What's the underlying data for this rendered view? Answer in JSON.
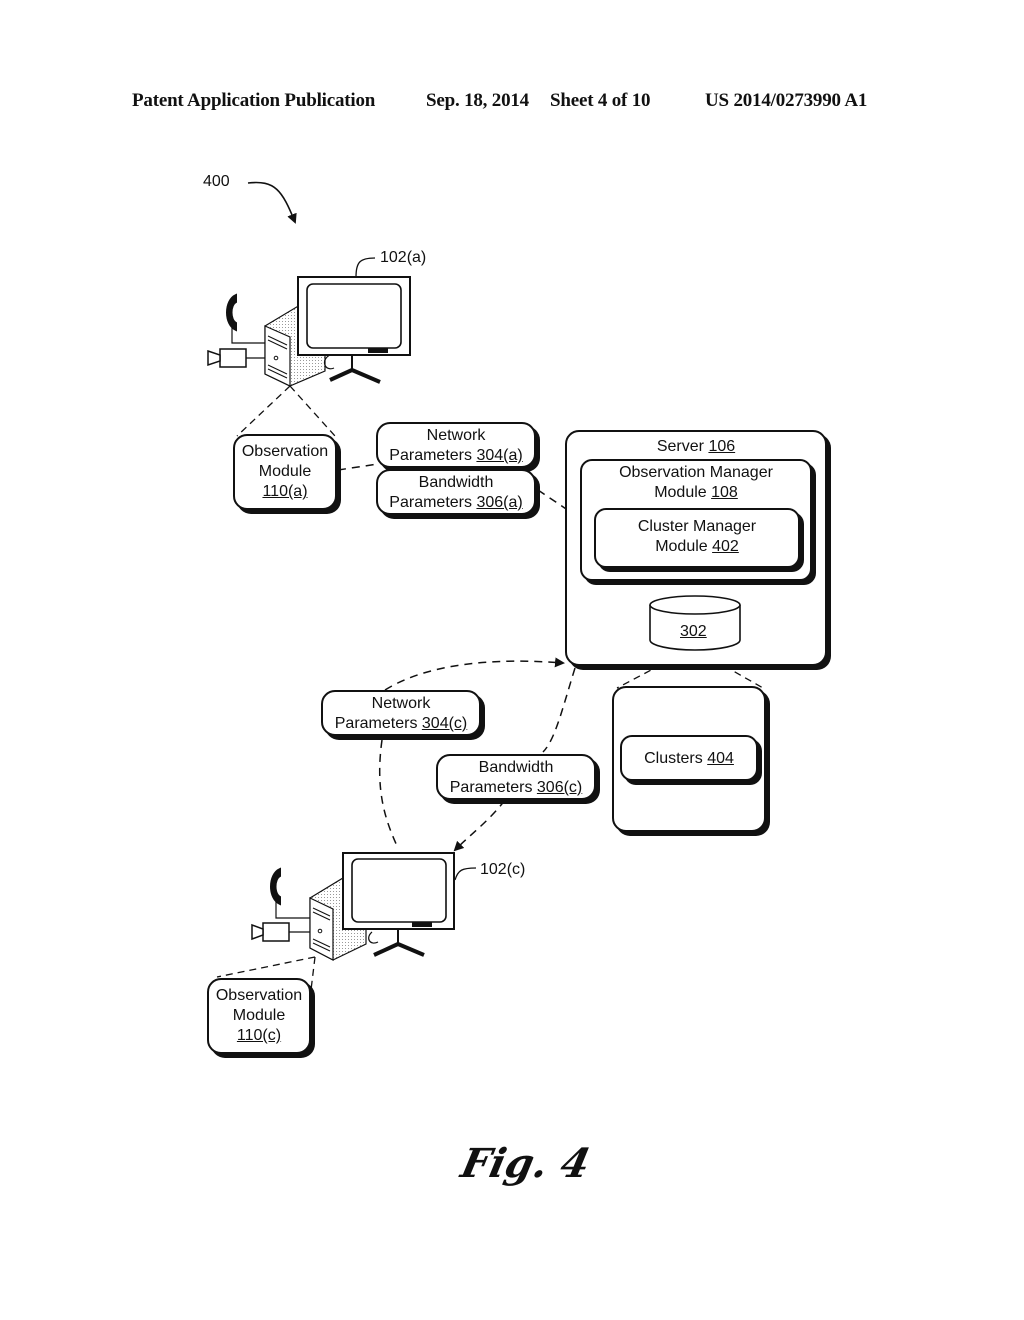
{
  "header": {
    "publication": "Patent Application Publication",
    "date": "Sep. 18, 2014",
    "sheet": "Sheet 4 of 10",
    "number": "US 2014/0273990 A1"
  },
  "figure": {
    "ref": "400",
    "caption": "Fig. 4"
  },
  "devices": [
    {
      "ref": "102(a)"
    },
    {
      "ref": "102(c)"
    }
  ],
  "observation_modules": [
    {
      "line1": "Observation",
      "line2": "Module",
      "ref": "110(a)"
    },
    {
      "line1": "Observation",
      "line2": "Module",
      "ref": "110(c)"
    }
  ],
  "parameters": {
    "network_a": {
      "line1": "Network",
      "line2": "Parameters ",
      "ref": "304(a)"
    },
    "bandwidth_a": {
      "line1": "Bandwidth",
      "line2": "Parameters ",
      "ref": "306(a)"
    },
    "network_c": {
      "line1": "Network",
      "line2": "Parameters ",
      "ref": "304(c)"
    },
    "bandwidth_c": {
      "line1": "Bandwidth",
      "line2": "Parameters ",
      "ref": "306(c)"
    }
  },
  "server": {
    "label": "Server ",
    "ref": "106",
    "observation_manager": {
      "line1": "Observation Manager",
      "line2": "Module ",
      "ref": "108"
    },
    "cluster_manager": {
      "line1": "Cluster Manager",
      "line2": "Module ",
      "ref": "402"
    },
    "datastore": {
      "ref": "302"
    }
  },
  "clusters": {
    "label": "Clusters ",
    "ref": "404"
  }
}
